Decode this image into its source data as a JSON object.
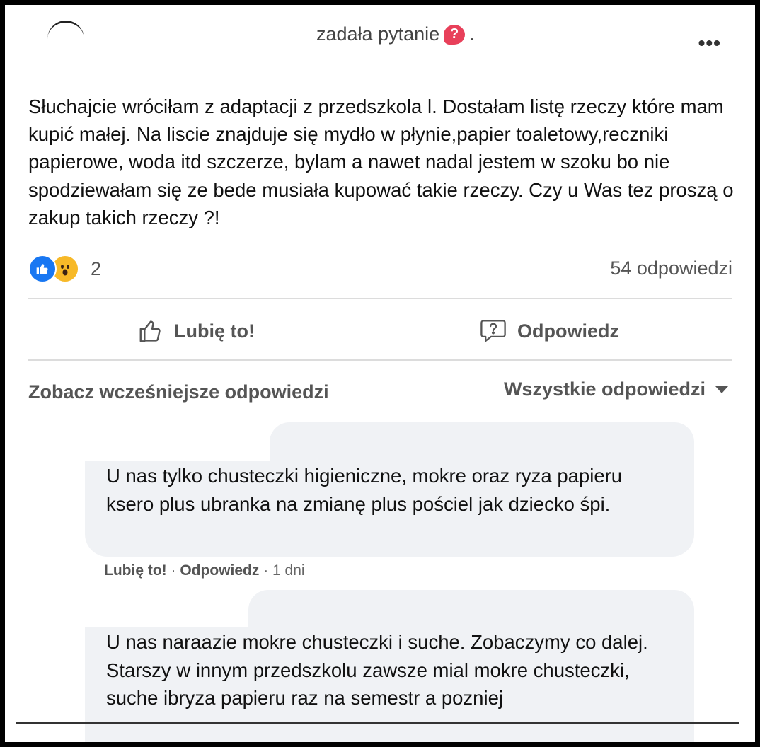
{
  "header": {
    "text": "zadała pytanie",
    "separator": ".",
    "question_badge": "?",
    "more_icon": "more-options-icon",
    "more_glyph": "•••"
  },
  "post": {
    "body": "Słuchajcie wróciłam z adaptacji z przedszkola l. Dostałam listę rzeczy które mam kupić małej. Na liscie znajduje się mydło w płynie,papier toaletowy,reczniki papierowe, woda  itd szczerze, bylam a nawet nadal jestem w szoku bo nie spodziewałam się ze bede musiała kupować takie rzeczy. Czy u Was tez proszą o zakup takich rzeczy ?!"
  },
  "reactions": {
    "icons": [
      "like-reaction-icon",
      "wow-reaction-icon"
    ],
    "count": "2",
    "answers": "54 odpowiedzi"
  },
  "actions": {
    "like_label": "Lubię to!",
    "answer_label": "Odpowiedz"
  },
  "comments_header": {
    "earlier": "Zobacz wcześniejsze odpowiedzi",
    "filter": "Wszystkie odpowiedzi"
  },
  "comments": [
    {
      "text": "U nas tylko chusteczki higieniczne, mokre oraz ryza papieru ksero plus ubranka na zmianę plus pościel jak dziecko śpi.",
      "like": "Lubię to!",
      "reply": "Odpowiedz",
      "sep": "·",
      "time": "1 dni"
    },
    {
      "text": "U nas naraazie mokre chusteczki i suche. Zobaczymy co dalej. Starszy w innym przedszkolu zawsze mial mokre chusteczki, suche ibryza papieru raz na semestr a pozniej"
    }
  ],
  "colors": {
    "like_blue": "#1877f2",
    "wow_yellow": "#f7b928",
    "question_red": "#e8405a",
    "bubble_bg": "#f0f2f5"
  }
}
